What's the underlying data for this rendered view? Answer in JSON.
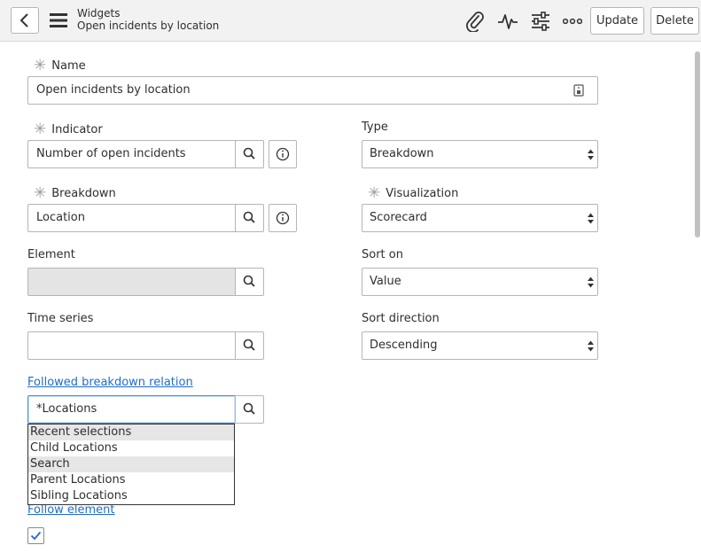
{
  "header": {
    "title": "Widgets",
    "subtitle": "Open incidents by location",
    "icons": [
      "back-arrow-icon",
      "hamburger-icon",
      "paperclip-icon",
      "activity-icon",
      "sliders-icon",
      "more-icon"
    ],
    "update_label": "Update",
    "delete_label": "Delete"
  },
  "form": {
    "name": {
      "label": "Name",
      "value": "Open incidents by location",
      "required": true
    },
    "indicator": {
      "label": "Indicator",
      "value": "Number of open incidents",
      "required": true
    },
    "type": {
      "label": "Type",
      "value": "Breakdown"
    },
    "breakdown": {
      "label": "Breakdown",
      "value": "Location",
      "required": true
    },
    "visualization": {
      "label": "Visualization",
      "value": "Scorecard",
      "required": true
    },
    "element": {
      "label": "Element",
      "value": ""
    },
    "sort_on": {
      "label": "Sort on",
      "value": "Value"
    },
    "time_series": {
      "label": "Time series",
      "value": ""
    },
    "sort_direction": {
      "label": "Sort direction",
      "value": "Descending"
    },
    "followed_breakdown_relation": {
      "label": "Followed breakdown relation",
      "value": "*Locations"
    },
    "follow_element": {
      "label": "Follow element",
      "checked": true
    }
  },
  "autocomplete": {
    "items": [
      {
        "label": "Recent selections",
        "group": true
      },
      {
        "label": "Child Locations",
        "group": false
      },
      {
        "label": "Search",
        "group": true
      },
      {
        "label": "Parent Locations",
        "group": false
      },
      {
        "label": "Sibling Locations",
        "group": false
      }
    ]
  },
  "colors": {
    "link": "#1f6ad1",
    "focus": "#3b8ee0",
    "checkmark": "#1f6ad1"
  }
}
